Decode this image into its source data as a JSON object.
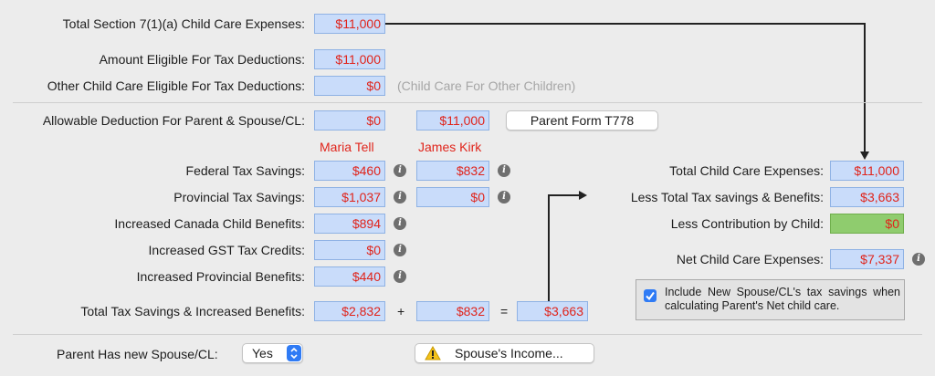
{
  "rows": {
    "total_section": {
      "label": "Total Section 7(1)(a) Child Care Expenses:",
      "value": "$11,000"
    },
    "amount_eligible": {
      "label": "Amount Eligible For Tax Deductions:",
      "value": "$11,000"
    },
    "other_eligible": {
      "label": "Other Child Care Eligible For Tax Deductions:",
      "value": "$0",
      "note": "(Child Care For Other Children)"
    },
    "allowable": {
      "label": "Allowable Deduction For Parent & Spouse/CL:",
      "parent": "$0",
      "spouse": "$11,000",
      "button": "Parent Form T778"
    }
  },
  "names": {
    "parent": "Maria Tell",
    "spouse": "James Kirk"
  },
  "savings": [
    {
      "label": "Federal Tax Savings:",
      "parent": "$460",
      "spouse": "$832"
    },
    {
      "label": "Provincial Tax Savings:",
      "parent": "$1,037",
      "spouse": "$0"
    },
    {
      "label": "Increased Canada Child Benefits:",
      "parent": "$894"
    },
    {
      "label": "Increased GST Tax Credits:",
      "parent": "$0"
    },
    {
      "label": "Increased Provincial Benefits:",
      "parent": "$440"
    }
  ],
  "total_savings": {
    "label": "Total Tax Savings & Increased Benefits:",
    "parent": "$2,832",
    "plus": "+",
    "spouse": "$832",
    "equals": "=",
    "total": "$3,663"
  },
  "summary": {
    "total_expenses": {
      "label": "Total Child Care Expenses:",
      "value": "$11,000"
    },
    "less_savings": {
      "label": "Less Total Tax savings & Benefits:",
      "value": "$3,663"
    },
    "less_contribution": {
      "label": "Less Contribution by Child:",
      "value": "$0"
    },
    "net": {
      "label": "Net Child Care Expenses:",
      "value": "$7,337"
    }
  },
  "checkbox": {
    "checked": true,
    "label": "Include New Spouse/CL's tax savings when calculating Parent's Net child care."
  },
  "footer": {
    "label": "Parent Has new Spouse/CL:",
    "select_value": "Yes",
    "button": "Spouse's Income..."
  },
  "info_symbol": "i",
  "colors": {
    "field_bg": "#c9dcfa",
    "value_text": "#e0241b",
    "green_field": "#8fcc6e",
    "names": "#e0241b"
  },
  "icons": {
    "info": "info-icon",
    "warning": "warning-icon",
    "select": "chevron-updown-icon",
    "check": "checkmark-icon",
    "connector": "arrow-connector"
  }
}
